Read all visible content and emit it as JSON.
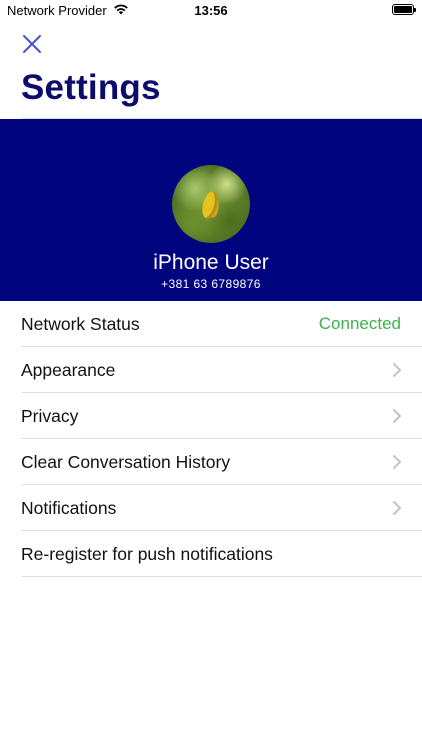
{
  "status_bar": {
    "carrier": "Network Provider",
    "time": "13:56",
    "icons": [
      "wifi-icon",
      "battery-icon"
    ]
  },
  "nav": {
    "close_icon": "close-icon",
    "title": "Settings"
  },
  "profile": {
    "name": "iPhone User",
    "phone": "+381 63 6789876",
    "header_color": "#00047e"
  },
  "settings": {
    "items": [
      {
        "label": "Network Status",
        "value": "Connected",
        "value_color": "#3bb24b"
      },
      {
        "label": "Appearance",
        "icon": "chevron-right-icon"
      },
      {
        "label": "Privacy",
        "icon": "chevron-right-icon"
      },
      {
        "label": "Clear Conversation History",
        "icon": "chevron-right-icon"
      },
      {
        "label": "Notifications",
        "icon": "chevron-right-icon"
      },
      {
        "label": "Re-register for push notifications"
      }
    ]
  },
  "colors": {
    "title": "#0c0d6b",
    "accent": "#4a4fd6",
    "connected": "#3bb24b"
  }
}
